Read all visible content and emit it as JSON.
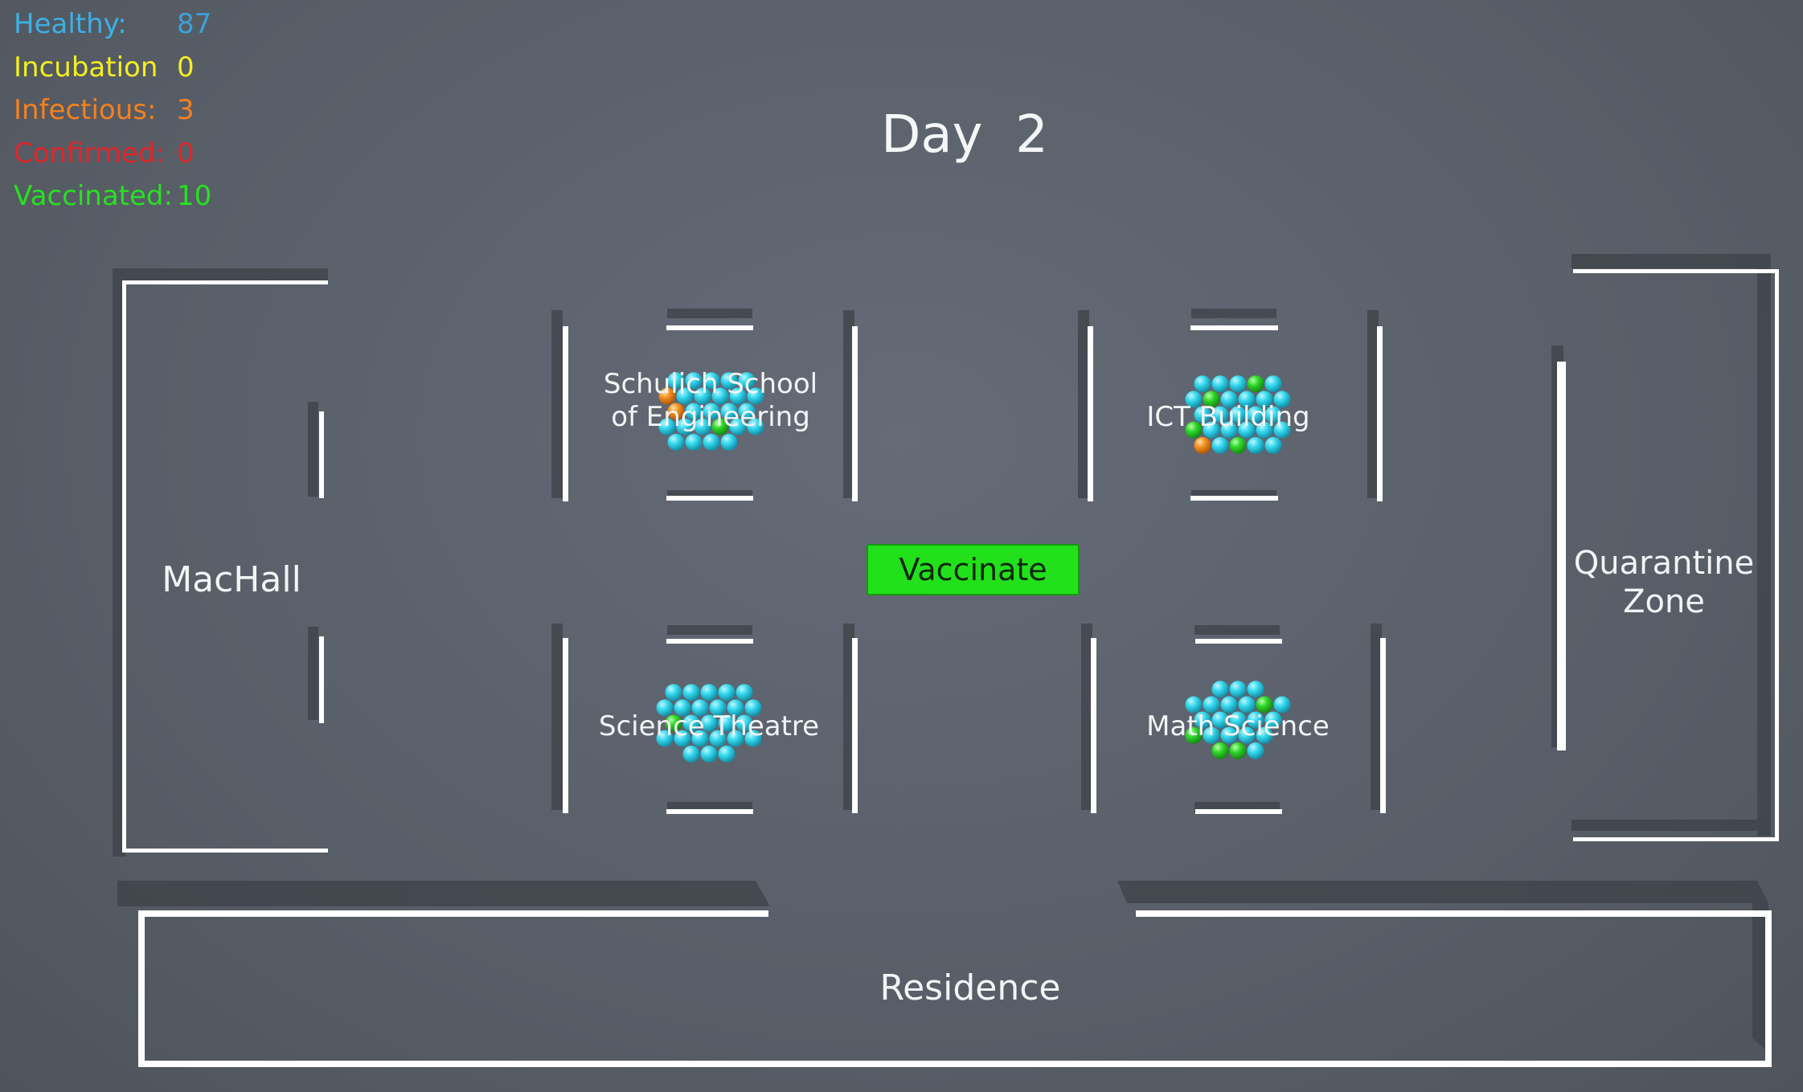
{
  "hud": {
    "stats": [
      {
        "label": "Healthy:",
        "value": "87",
        "color": "#3cb0e6"
      },
      {
        "label": "Incubation",
        "value": "0",
        "color": "#f3ef1e"
      },
      {
        "label": "Infectious:",
        "value": "3",
        "color": "#f5801e"
      },
      {
        "label": "Confirmed:",
        "value": "0",
        "color": "#e0262a"
      },
      {
        "label": "Vaccinated:",
        "value": "10",
        "color": "#28e022"
      }
    ]
  },
  "day": {
    "label": "Day  2"
  },
  "actions": {
    "vaccinate_label": "Vaccinate"
  },
  "zones": {
    "machall": "MacHall",
    "schulich": [
      "Schulich School",
      "of Engineering"
    ],
    "ict": "ICT Building",
    "science_theatre": "Science Theatre",
    "math_science": "Math Science",
    "quarantine": [
      "Quarantine",
      "Zone"
    ],
    "residence": "Residence"
  },
  "colors": {
    "floor": "#5b616b",
    "wall": "#ffffff",
    "shadow": "#3a3e45",
    "healthy_agent": "#33d9ee",
    "vaccinated_agent": "#2ed62a",
    "infectious_agent": "#f59020",
    "button": "#22e11b"
  },
  "agent_groups": [
    {
      "building": "schulich",
      "healthy": 23,
      "vaccinated": 1,
      "infectious": 2
    },
    {
      "building": "ict",
      "healthy": 22,
      "vaccinated": 4,
      "infectious": 1
    },
    {
      "building": "science_theatre",
      "healthy": 24,
      "vaccinated": 1,
      "infectious": 0
    },
    {
      "building": "math_science",
      "healthy": 18,
      "vaccinated": 4,
      "infectious": 0
    }
  ]
}
